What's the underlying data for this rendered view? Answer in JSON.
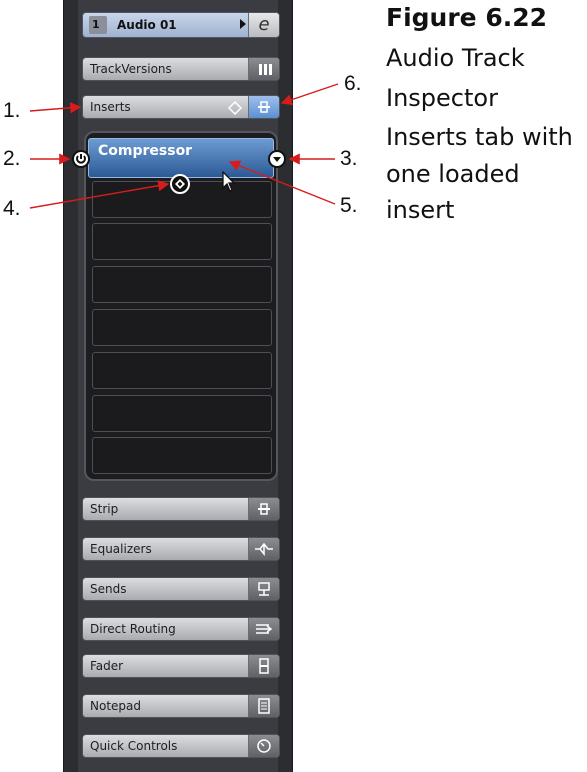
{
  "figure": {
    "title": "Figure 6.22",
    "caption_lines": [
      "Audio Track",
      "Inspector",
      "Inserts tab with",
      "one loaded",
      "insert"
    ]
  },
  "callouts": [
    "1.",
    "2.",
    "3.",
    "4.",
    "5.",
    "6."
  ],
  "track": {
    "number": "1",
    "name": "Audio 01"
  },
  "sections_top": [
    {
      "label": "TrackVersions",
      "icon": "track-versions-icon"
    },
    {
      "label": "Inserts",
      "icon": "inserts-icon"
    }
  ],
  "inserts": {
    "loaded_plugin": "Compressor",
    "empty_slots": 7
  },
  "sections_bottom": [
    {
      "label": "Strip",
      "icon": "strip-icon"
    },
    {
      "label": "Equalizers",
      "icon": "equalizer-icon"
    },
    {
      "label": "Sends",
      "icon": "sends-icon"
    },
    {
      "label": "Direct Routing",
      "icon": "direct-routing-icon"
    },
    {
      "label": "Fader",
      "icon": "fader-icon"
    },
    {
      "label": "Notepad",
      "icon": "notepad-icon"
    },
    {
      "label": "Quick Controls",
      "icon": "quick-controls-icon"
    }
  ],
  "colors": {
    "accent_blue": "#3a6ba8",
    "annotation_red": "#d81c1c"
  }
}
